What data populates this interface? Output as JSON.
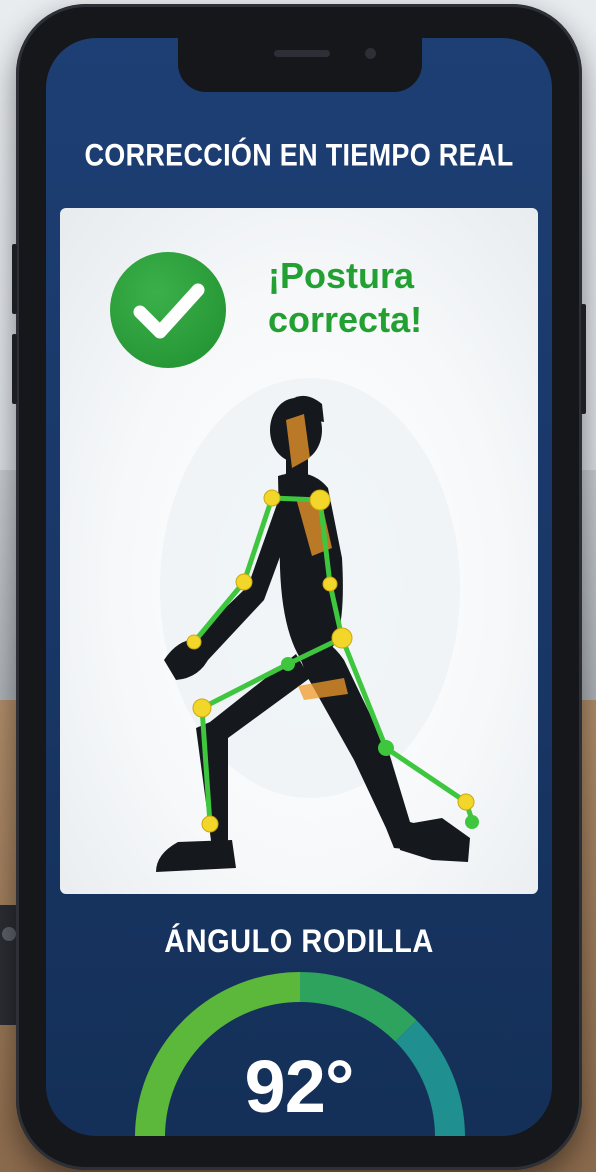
{
  "screen": {
    "title": "CORRECCIÓN EN TIEMPO REAL",
    "status": {
      "icon": "check-circle-icon",
      "text": "¡Postura correcta!",
      "color": "#22a032"
    },
    "pose": {
      "exercise_figure": "lunge-skeleton-overlay",
      "joint_color": "#f2d62a",
      "bone_color": "#3ec63e",
      "highlight_color": "#f09a2a"
    },
    "gauge": {
      "label": "ÁNGULO RODILLA",
      "value": 92,
      "value_text": "92°",
      "colors": [
        "#5cb83a",
        "#2ea35e",
        "#1f8f8f"
      ]
    }
  }
}
